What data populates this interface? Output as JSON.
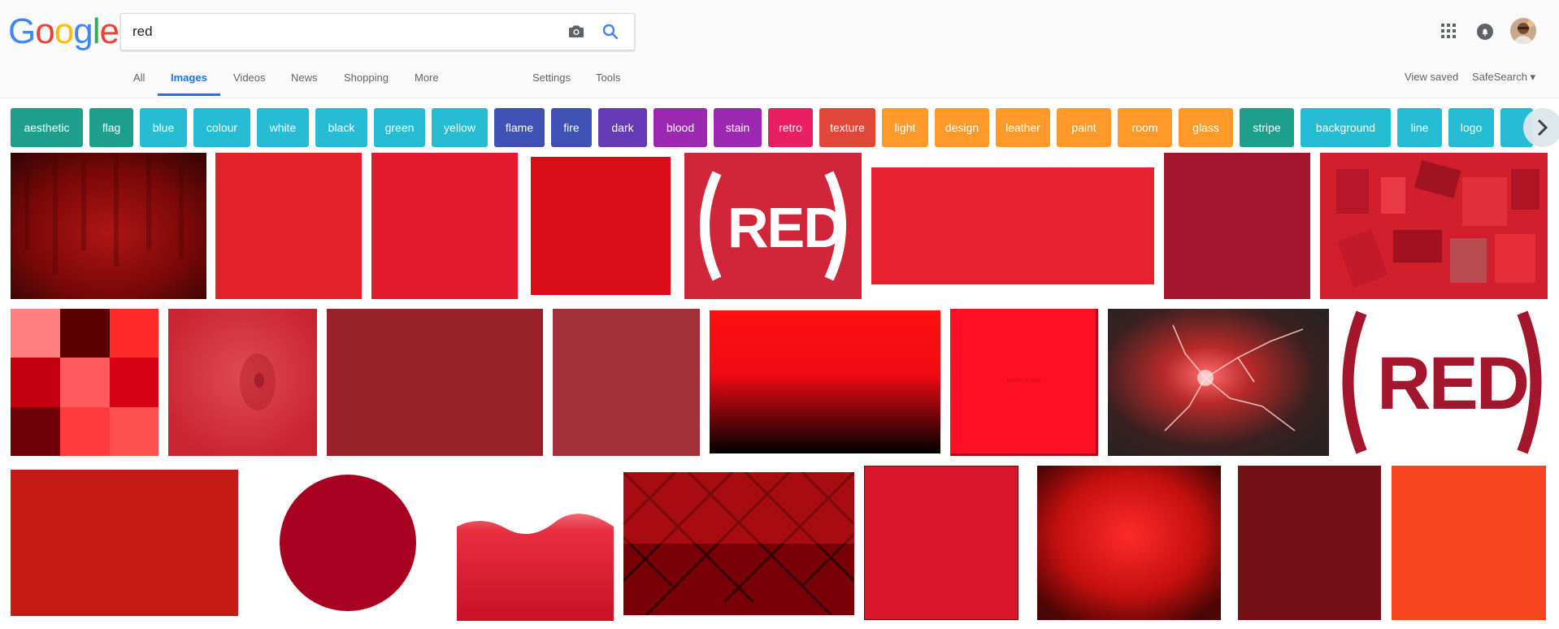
{
  "logo": {
    "letters": [
      "G",
      "o",
      "o",
      "g",
      "l",
      "e"
    ],
    "colors": [
      "#4285F4",
      "#EA4335",
      "#FBBC05",
      "#4285F4",
      "#34A853",
      "#EA4335"
    ]
  },
  "search": {
    "query": "red"
  },
  "icons": {
    "camera": "camera-icon",
    "search": "search-icon",
    "apps": "apps-grid-icon",
    "notifications": "bell-icon"
  },
  "tabs": {
    "all": "All",
    "images": "Images",
    "videos": "Videos",
    "news": "News",
    "shopping": "Shopping",
    "more": "More",
    "settings": "Settings",
    "tools": "Tools"
  },
  "right_links": {
    "view_saved": "View saved",
    "safesearch": "SafeSearch ▾"
  },
  "chips": [
    {
      "label": "aesthetic",
      "color": "#1e9e8d"
    },
    {
      "label": "flag",
      "color": "#1e9e8d"
    },
    {
      "label": "blue",
      "color": "#25bcd4"
    },
    {
      "label": "colour",
      "color": "#25bcd4"
    },
    {
      "label": "white",
      "color": "#25bcd4"
    },
    {
      "label": "black",
      "color": "#25bcd4"
    },
    {
      "label": "green",
      "color": "#25bcd4"
    },
    {
      "label": "yellow",
      "color": "#25bcd4"
    },
    {
      "label": "flame",
      "color": "#3f51b5"
    },
    {
      "label": "fire",
      "color": "#3f51b5"
    },
    {
      "label": "dark",
      "color": "#673ab7"
    },
    {
      "label": "blood",
      "color": "#9c27b0"
    },
    {
      "label": "stain",
      "color": "#9c27b0"
    },
    {
      "label": "retro",
      "color": "#e91e63"
    },
    {
      "label": "texture",
      "color": "#e0473a"
    },
    {
      "label": "light",
      "color": "#ff9a2a"
    },
    {
      "label": "design",
      "color": "#ff9a2a"
    },
    {
      "label": "leather",
      "color": "#ff9a2a"
    },
    {
      "label": "paint",
      "color": "#ff9a2a"
    },
    {
      "label": "room",
      "color": "#ff9a2a"
    },
    {
      "label": "glass",
      "color": "#ff9a2a"
    },
    {
      "label": "stripe",
      "color": "#1e9e8d"
    },
    {
      "label": "background",
      "color": "#25bcd4"
    },
    {
      "label": "line",
      "color": "#25bcd4"
    },
    {
      "label": "logo",
      "color": "#25bcd4"
    },
    {
      "label": "",
      "color": "#25bcd4"
    }
  ],
  "images": {
    "red_logo_text": "RED",
    "magic_stone_caption": "MAGIC STONE",
    "colors": {
      "dark_texture": "#8a0a0a",
      "bright_red": "#e8101f",
      "crimson": "#a3162d",
      "brick": "#99222a",
      "dusty_red": "#a3313a",
      "orange_red": "#f5461f"
    }
  }
}
